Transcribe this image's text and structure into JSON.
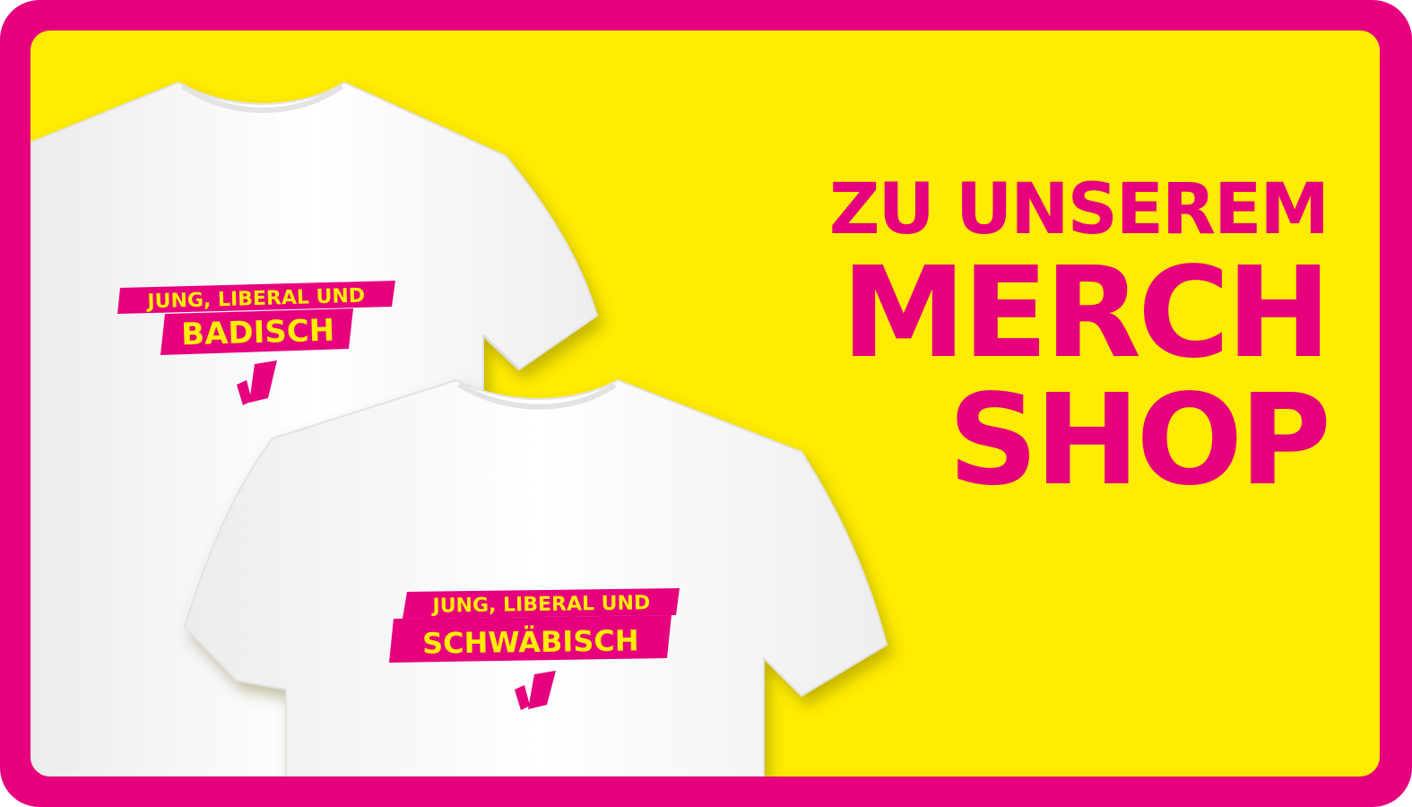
{
  "cta": {
    "line1": "ZU UNSEREM",
    "line2": "MERCH",
    "line3": "SHOP"
  },
  "shirts": [
    {
      "top_text": "JUNG, LIBERAL UND",
      "bottom_text": "BADISCH"
    },
    {
      "top_text": "JUNG, LIBERAL UND",
      "bottom_text": "SCHWÄBISCH"
    }
  ],
  "colors": {
    "frame": "#e6007e",
    "background": "#ffec00",
    "shirt": "#ffffff"
  },
  "icons": [
    "jl-logo-icon"
  ]
}
